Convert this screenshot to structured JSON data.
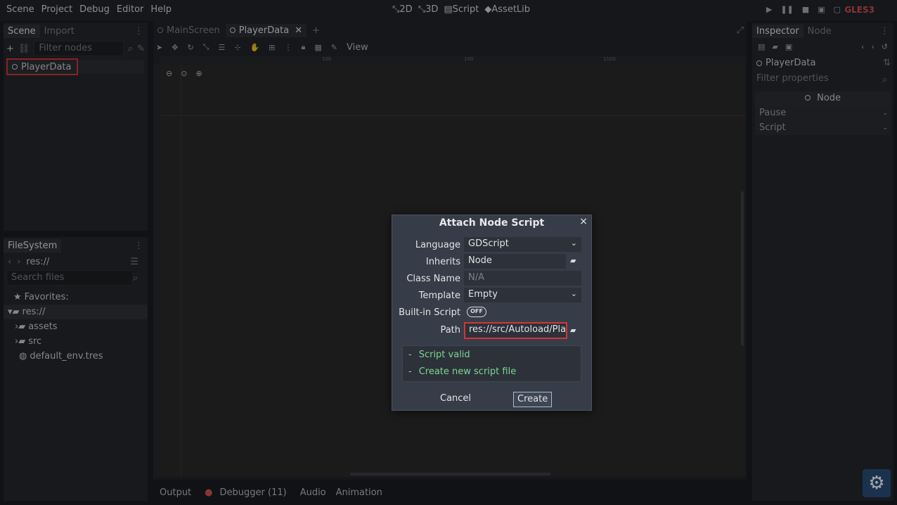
{
  "menubar": {
    "items": [
      "Scene",
      "Project",
      "Debug",
      "Editor",
      "Help"
    ]
  },
  "modes": {
    "items": [
      "2D",
      "3D",
      "Script",
      "AssetLib"
    ]
  },
  "renderer": "GLES3",
  "scene_panel": {
    "tabs": [
      "Scene",
      "Import"
    ],
    "filter_placeholder": "Filter nodes",
    "root_node": "PlayerData"
  },
  "filesystem": {
    "title": "FileSystem",
    "path": "res://",
    "search_placeholder": "Search files",
    "favorites": "Favorites:",
    "root": "res://",
    "items": [
      "assets",
      "src",
      "default_env.tres"
    ]
  },
  "editor_tabs": [
    "MainScreen",
    "PlayerData"
  ],
  "toolbar": {
    "view": "View"
  },
  "ruler_ticks": [
    "100",
    "100",
    "1100"
  ],
  "inspector": {
    "tabs": [
      "Inspector",
      "Node"
    ],
    "object": "PlayerData",
    "filter_placeholder": "Filter properties",
    "section": "Node",
    "props": [
      "Pause",
      "Script"
    ]
  },
  "bottom_tabs": [
    "Output",
    "Debugger (11)",
    "Audio",
    "Animation"
  ],
  "dialog": {
    "title": "Attach Node Script",
    "close": "×",
    "language_label": "Language",
    "language_value": "GDScript",
    "inherits_label": "Inherits",
    "inherits_value": "Node",
    "classname_label": "Class Name",
    "classname_value": "N/A",
    "template_label": "Template",
    "template_value": "Empty",
    "builtin_label": "Built-in Script",
    "builtin_toggle": "OFF",
    "path_label": "Path",
    "path_value": "res://src/Autoload/Play",
    "status": [
      "Script valid",
      "Create new script file"
    ],
    "cancel": "Cancel",
    "create": "Create"
  }
}
